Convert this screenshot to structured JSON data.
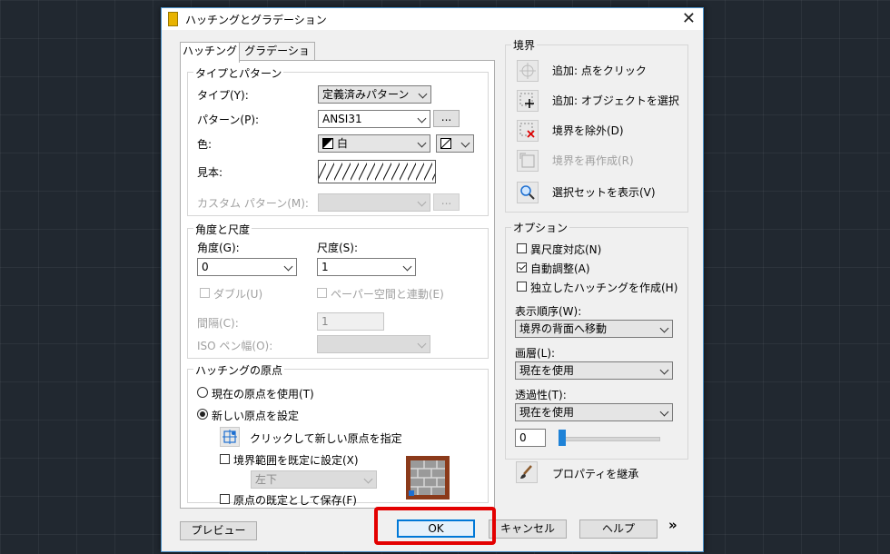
{
  "dialog": {
    "title": "ハッチングとグラデーション",
    "tabs": [
      "ハッチング",
      "グラデーション"
    ]
  },
  "type_pattern": {
    "title": "タイプとパターン",
    "type_label": "タイプ(Y):",
    "type_value": "定義済みパターン",
    "pattern_label": "パターン(P):",
    "pattern_value": "ANSI31",
    "pattern_browse": "...",
    "color_label": "色:",
    "color_value": "白",
    "sample_label": "見本:",
    "custom_label": "カスタム パターン(M):",
    "custom_browse": "..."
  },
  "angle_scale": {
    "title": "角度と尺度",
    "angle_label": "角度(G):",
    "angle_value": "0",
    "scale_label": "尺度(S):",
    "scale_value": "1",
    "double_label": "ダブル(U)",
    "paper_label": "ペーパー空間と連動(E)",
    "spacing_label": "間隔(C):",
    "spacing_value": "1",
    "iso_label": "ISO ペン幅(O):"
  },
  "origin": {
    "title": "ハッチングの原点",
    "current_label": "現在の原点を使用(T)",
    "new_label": "新しい原点を設定",
    "click_label": "クリックして新しい原点を指定",
    "default_boundary_label": "境界範囲を既定に設定(X)",
    "position_value": "左下",
    "store_label": "原点の既定として保存(F)"
  },
  "boundaries": {
    "title": "境界",
    "add_pick": "追加: 点をクリック",
    "add_select": "追加: オブジェクトを選択",
    "remove": "境界を除外(D)",
    "recreate": "境界を再作成(R)",
    "view": "選択セットを表示(V)"
  },
  "options": {
    "title": "オプション",
    "annotative": "異尺度対応(N)",
    "associative": "自動調整(A)",
    "separate": "独立したハッチングを作成(H)",
    "draw_order_label": "表示順序(W):",
    "draw_order_value": "境界の背面へ移動",
    "layer_label": "画層(L):",
    "layer_value": "現在を使用",
    "transparency_label": "透過性(T):",
    "transparency_value": "現在を使用",
    "transparency_number": "0",
    "transparency_slider_fraction": 0,
    "inherit": "プロパティを継承"
  },
  "footer": {
    "preview": "プレビュー",
    "ok": "OK",
    "cancel": "キャンセル",
    "help": "ヘルプ",
    "more": "»"
  },
  "colors": {
    "highlight": "#e30000",
    "brick": "#8b3a1a",
    "slider": "#1e82d7"
  }
}
